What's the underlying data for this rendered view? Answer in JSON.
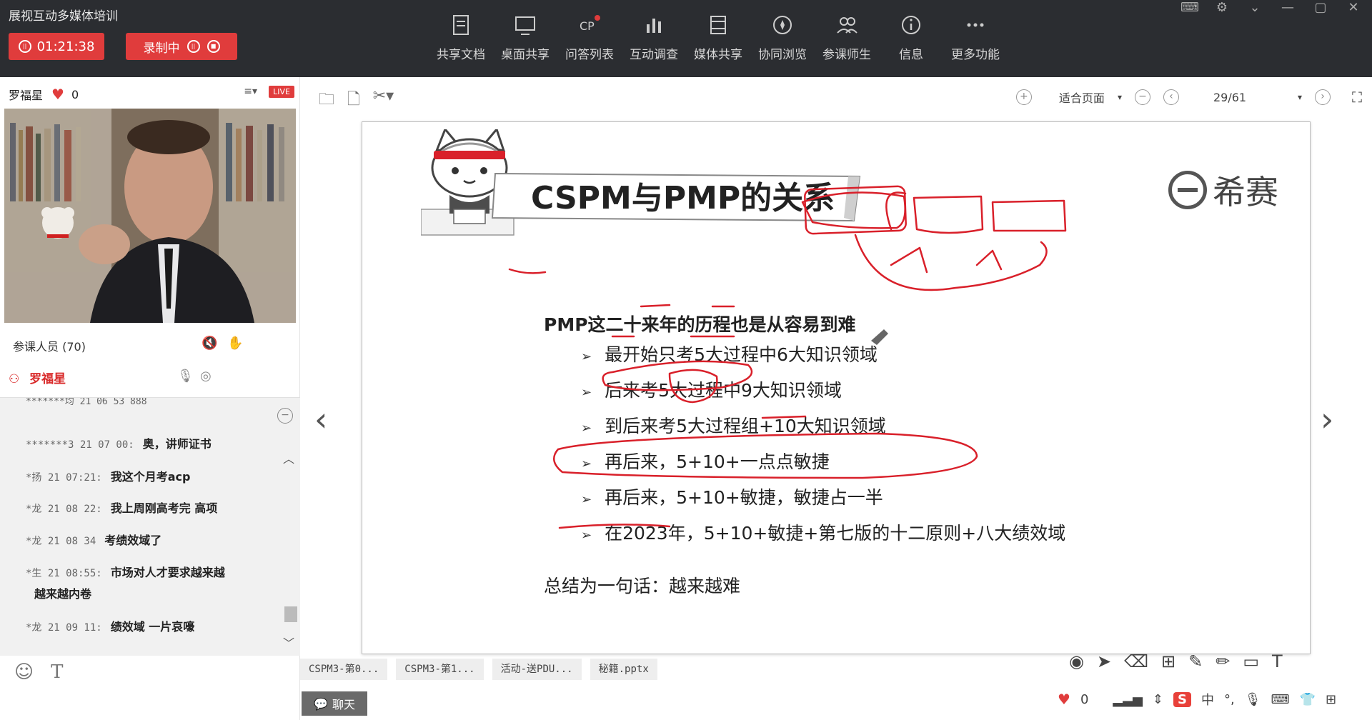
{
  "app": {
    "title": "展视互动多媒体培训"
  },
  "session": {
    "timer": "01:21:38",
    "recording_label": "录制中"
  },
  "toolbar": {
    "items": [
      {
        "label": "共享文档",
        "icon": "document-icon"
      },
      {
        "label": "桌面共享",
        "icon": "monitor-icon"
      },
      {
        "label": "问答列表",
        "icon": "qa-icon"
      },
      {
        "label": "互动调查",
        "icon": "bar-chart-icon"
      },
      {
        "label": "媒体共享",
        "icon": "film-icon"
      },
      {
        "label": "协同浏览",
        "icon": "compass-icon"
      },
      {
        "label": "参课师生",
        "icon": "users-icon"
      },
      {
        "label": "信息",
        "icon": "info-icon"
      },
      {
        "label": "更多功能",
        "icon": "more-icon"
      }
    ]
  },
  "presenter": {
    "name": "罗福星",
    "likes": "0",
    "live": "LIVE"
  },
  "participants": {
    "label": "参课人员 (70)",
    "current_user": "罗福星"
  },
  "chat": {
    "cut_line": "*******均  21 06 53  888",
    "messages": [
      {
        "meta": "*******3 21 07 00:",
        "text": "奥，讲师证书"
      },
      {
        "meta": "*扬 21 07:21:",
        "text": "我这个月考acp"
      },
      {
        "meta": "*龙 21 08 22:",
        "text": "我上周刚高考完 高项"
      },
      {
        "meta": "*龙 21 08 34",
        "text": "考绩效域了"
      },
      {
        "meta": "*生 21 08:55:",
        "text": "市场对人才要求越来越"
      },
      {
        "meta": "",
        "text": "越来越内卷"
      },
      {
        "meta": "*龙 21 09 11:",
        "text": "绩效域 一片哀嚎"
      }
    ]
  },
  "doc_toolbar": {
    "fit_label": "适合页面",
    "page": "29/61"
  },
  "slide": {
    "title": "CSPM与PMP的关系",
    "brand": "希赛",
    "heading": "PMP这二十来年的历程也是从容易到难",
    "bullets": [
      "最开始只考5大过程中6大知识领域",
      "后来考5大过程中9大知识领域",
      "到后来考5大过程组+10大知识领域",
      "再后来，5+10+一点点敏捷",
      "再后来，5+10+敏捷，敏捷占一半",
      "在2023年，5+10+敏捷+第七版的十二原则+八大绩效域"
    ],
    "summary": "总结为一句话：越来越难",
    "ink_color": "#d9202a"
  },
  "file_tabs": [
    "CSPM3-第0...",
    "CSPM3-第1...",
    "活动-送PDU...",
    "秘籍.pptx"
  ],
  "chat_tab": "聊天",
  "statusbar": {
    "likes": "0",
    "ime": "中"
  }
}
